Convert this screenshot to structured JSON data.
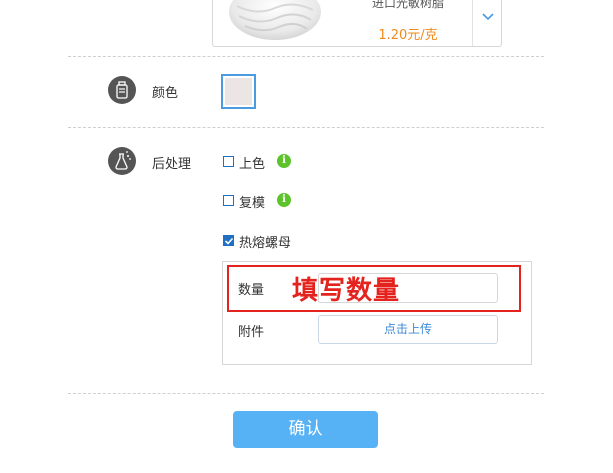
{
  "material": {
    "name": "进口光敏树脂",
    "price": "1.20元/克"
  },
  "color_row": {
    "label": "颜色",
    "icon": "paint-bottle-icon",
    "selected_color": "#ebe6e3",
    "swatch_border": "#4b9be3"
  },
  "post_processing": {
    "label": "后处理",
    "icon": "spray-flask-icon",
    "options": [
      {
        "label": "上色",
        "checked": false,
        "has_info": true
      },
      {
        "label": "复模",
        "checked": false,
        "has_info": true
      },
      {
        "label": "热熔螺母",
        "checked": true,
        "has_info": false
      }
    ],
    "nut_panel": {
      "quantity_label": "数量",
      "quantity_value": "",
      "attachment_label": "附件",
      "upload_label": "点击上传"
    }
  },
  "annotation": {
    "text": "填写数量",
    "color": "#e5231e"
  },
  "confirm_label": "确认",
  "colors": {
    "accent": "#56b1f5",
    "price": "#f08a1c",
    "info": "#5cc32a",
    "checkbox": "#1f6fc2"
  }
}
